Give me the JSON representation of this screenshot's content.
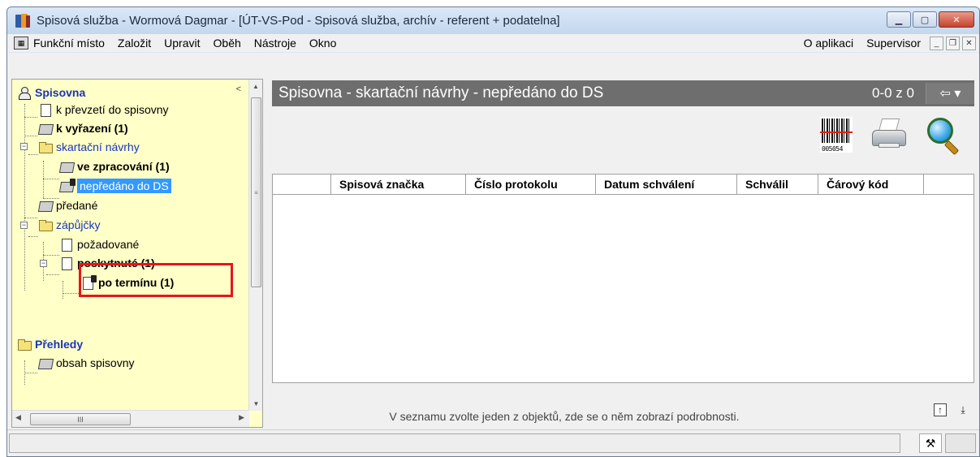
{
  "window": {
    "title": "Spisová služba - Wormová Dagmar - [ÚT-VS-Pod - Spisová služba, archív - referent + podatelna]"
  },
  "menu": {
    "items": [
      "Funkční místo",
      "Založit",
      "Upravit",
      "Oběh",
      "Nástroje",
      "Okno"
    ],
    "right_items": [
      "O aplikaci",
      "Supervisor"
    ]
  },
  "tree": {
    "collapse_glyph": "<",
    "root": "Spisovna",
    "nodes": [
      "k převzetí do spisovny",
      "k vyřazení (1)",
      "skartační návrhy",
      "ve zpracování (1)",
      "nepředáno do DS",
      "předané",
      "zápůjčky",
      "požadované",
      "poskytnuté (1)",
      "po termínu (1)"
    ],
    "section2": "Přehledy",
    "section2_nodes": [
      "obsah spisovny"
    ]
  },
  "panel": {
    "title": "Spisovna - skartační návrhy - nepředáno do DS",
    "counter": "0-0 z 0",
    "nav_glyph": "⇦ ▾"
  },
  "grid": {
    "columns": [
      "Spisová značka",
      "Číslo protokolu",
      "Datum schválení",
      "Schválil",
      "Čárový kód"
    ]
  },
  "barcode_digits": "005054",
  "info_text": "V seznamu zvolte jeden z objektů, zde se o něm zobrazí podrobnosti.",
  "colors": {
    "tree_background": "#ffffc8",
    "selection": "#3399ff",
    "header_bar": "#6e6e6e",
    "highlight_box": "#e8141c"
  }
}
